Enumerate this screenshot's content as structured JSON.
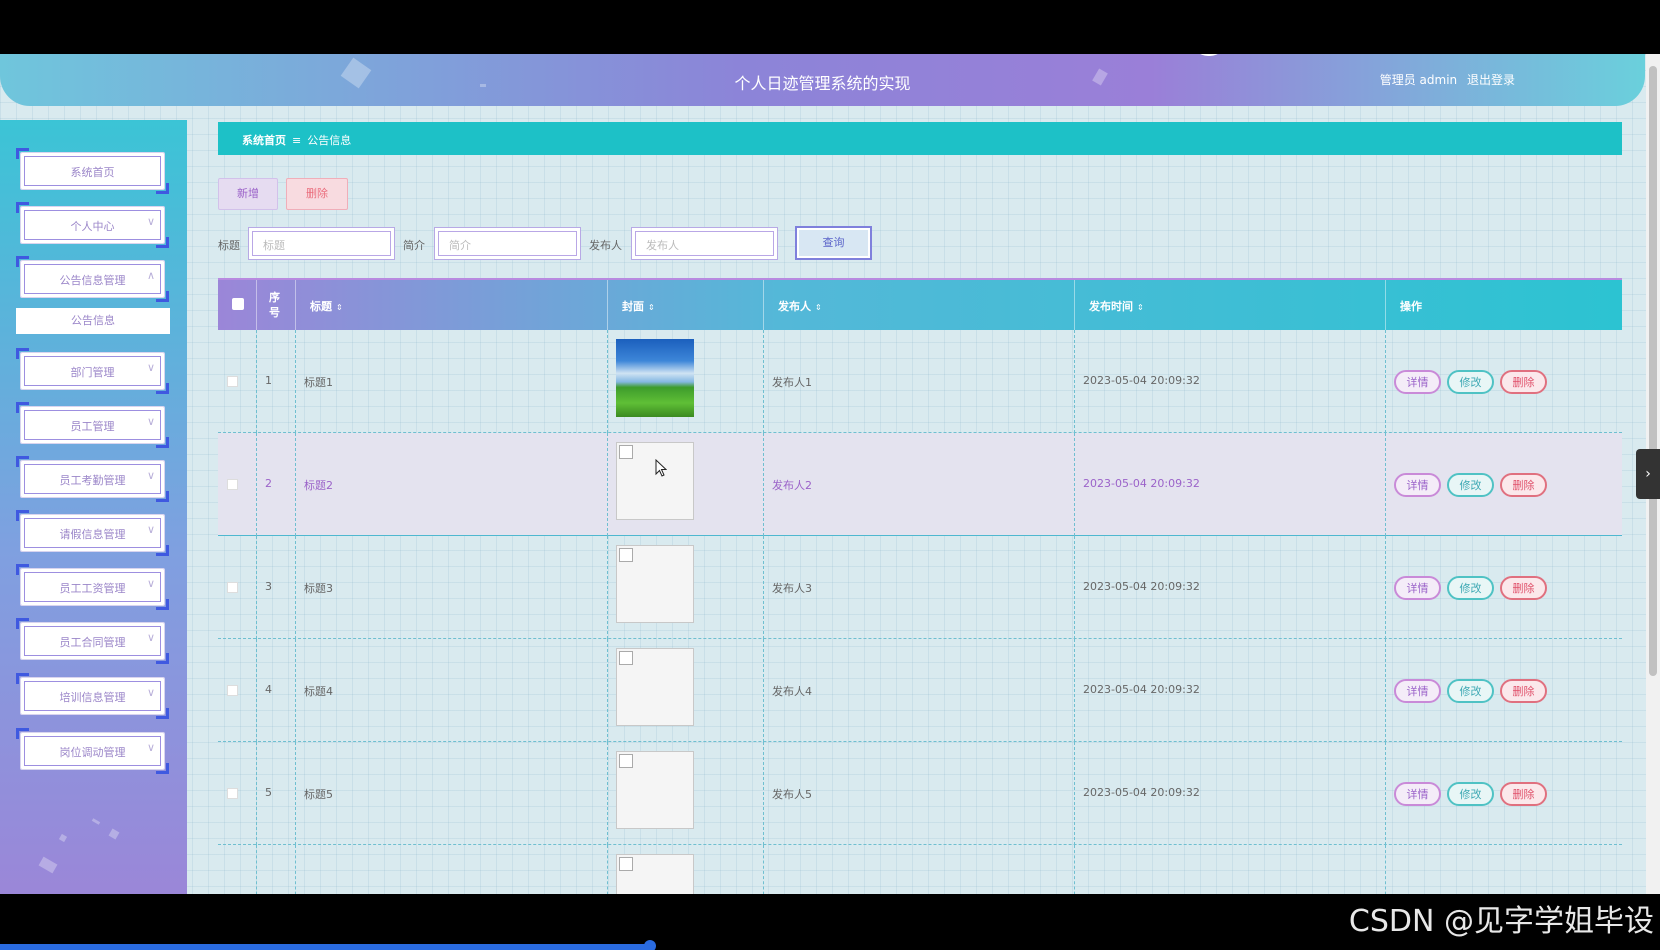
{
  "header": {
    "title": "个人日迹管理系统的实现",
    "user_label": "管理员 admin",
    "logout": "退出登录"
  },
  "sidebar": {
    "items": [
      {
        "label": "系统首页"
      },
      {
        "label": "个人中心",
        "chevron": "∨"
      },
      {
        "label": "公告信息管理",
        "chevron": "∧"
      },
      {
        "label": "部门管理",
        "chevron": "∨"
      },
      {
        "label": "员工管理",
        "chevron": "∨"
      },
      {
        "label": "员工考勤管理",
        "chevron": "∨"
      },
      {
        "label": "请假信息管理",
        "chevron": "∨"
      },
      {
        "label": "员工工资管理",
        "chevron": "∨"
      },
      {
        "label": "员工合同管理",
        "chevron": "∨"
      },
      {
        "label": "培训信息管理",
        "chevron": "∨"
      },
      {
        "label": "岗位调动管理",
        "chevron": "∨"
      }
    ],
    "sub_item": "公告信息"
  },
  "breadcrumb": {
    "home": "系统首页",
    "sep": "≡",
    "current": "公告信息"
  },
  "toolbar": {
    "add": "新增",
    "delete": "删除"
  },
  "search": {
    "title_label": "标题",
    "title_placeholder": "标题",
    "intro_label": "简介",
    "intro_placeholder": "简介",
    "publisher_label": "发布人",
    "publisher_placeholder": "发布人",
    "button": "查询"
  },
  "table": {
    "headers": {
      "index": "序号",
      "title": "标题",
      "cover": "封面",
      "publisher": "发布人",
      "time": "发布时间",
      "action": "操作"
    },
    "sort_icon": "⇕",
    "rows": [
      {
        "index": "1",
        "title": "标题1",
        "publisher": "发布人1",
        "time": "2023-05-04 20:09:32"
      },
      {
        "index": "2",
        "title": "标题2",
        "publisher": "发布人2",
        "time": "2023-05-04 20:09:32"
      },
      {
        "index": "3",
        "title": "标题3",
        "publisher": "发布人3",
        "time": "2023-05-04 20:09:32"
      },
      {
        "index": "4",
        "title": "标题4",
        "publisher": "发布人4",
        "time": "2023-05-04 20:09:32"
      },
      {
        "index": "5",
        "title": "标题5",
        "publisher": "发布人5",
        "time": "2023-05-04 20:09:32"
      }
    ],
    "actions": {
      "detail": "详情",
      "edit": "修改",
      "delete": "删除"
    }
  },
  "side_tab": "›",
  "watermark": "CSDN @见字学姐毕设",
  "colors": {
    "accent": "#1dc1c7",
    "purple": "#9b86d8",
    "danger": "#e0506a"
  }
}
